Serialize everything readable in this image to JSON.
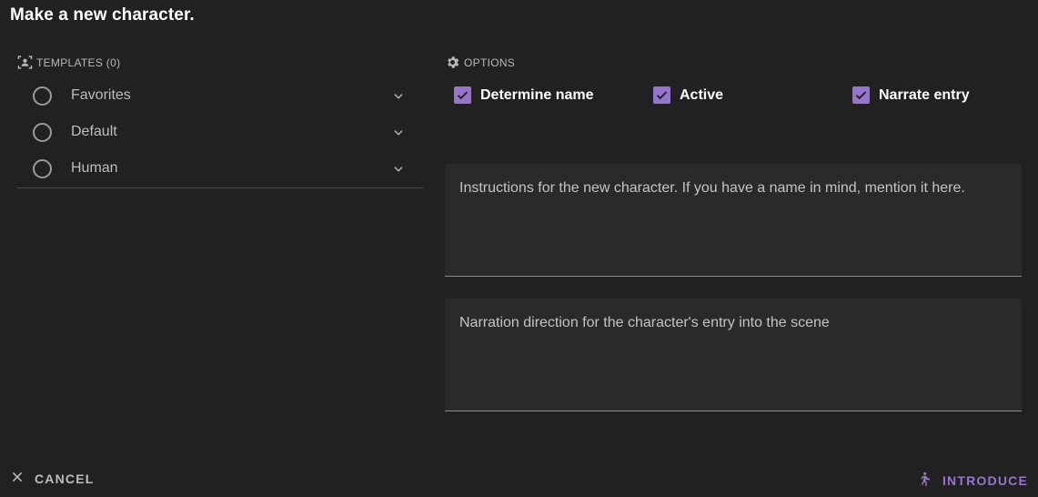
{
  "dialog": {
    "title": "Make a new character."
  },
  "templates": {
    "header_label": "TEMPLATES (0)",
    "header_icon": "account-group-icon",
    "items": [
      {
        "label": "Favorites",
        "selected": false
      },
      {
        "label": "Default",
        "selected": false
      },
      {
        "label": "Human",
        "selected": false
      }
    ]
  },
  "options": {
    "header_label": "OPTIONS",
    "header_icon": "gear-icon",
    "checkboxes": [
      {
        "label": "Determine name",
        "checked": true
      },
      {
        "label": "Active",
        "checked": true
      },
      {
        "label": "Narrate entry",
        "checked": true
      }
    ],
    "accent_color": "#9575cd"
  },
  "fields": {
    "instructions_placeholder": "Instructions for the new character. If you have a name in mind, mention it here.",
    "narration_placeholder": "Narration direction for the character's entry into the scene"
  },
  "footer": {
    "cancel_label": "CANCEL",
    "introduce_label": "INTRODUCE"
  }
}
